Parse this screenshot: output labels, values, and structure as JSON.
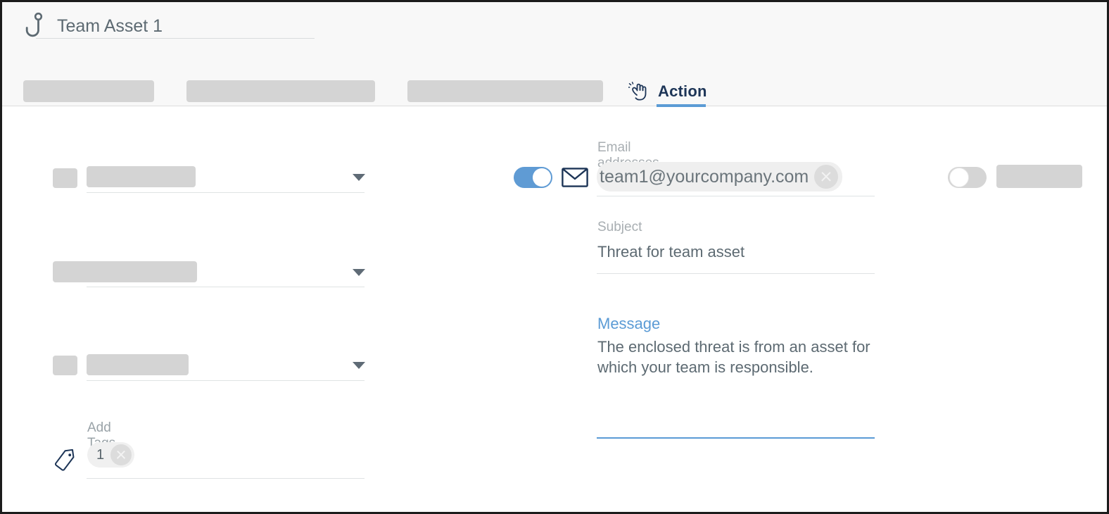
{
  "header": {
    "hook_icon": "fish-hook-icon",
    "asset_title": "Team Asset 1"
  },
  "tabs": {
    "redacted_count": 3,
    "active": {
      "icon": "hand-pointer-icon",
      "label": "Action"
    },
    "accent_color": "#5b9bd5"
  },
  "left_form": {
    "rows": [
      {
        "has_square": true,
        "redacted": true,
        "has_caret": true
      },
      {
        "has_square": false,
        "redacted": true,
        "has_caret": true
      },
      {
        "has_square": true,
        "redacted": true,
        "has_caret": true
      }
    ],
    "tags": {
      "icon": "tag-icon",
      "label": "Add Tags",
      "chips": [
        {
          "text": "1",
          "remove": "remove-tag-icon"
        }
      ]
    }
  },
  "email_action": {
    "enabled_toggle": {
      "state": "on",
      "color": "#5f9bd4"
    },
    "icon": "envelope-icon",
    "email_label": "Email addresses",
    "email_chips": [
      {
        "text": "team1@yourcompany.com",
        "remove": "remove-email-icon"
      }
    ],
    "subject_label": "Subject",
    "subject_value": "Threat for team asset",
    "message_label": "Message",
    "message_value": "The enclosed threat is from an asset for which your team is responsible.",
    "message_focus_color": "#5b9bd5"
  },
  "right_action": {
    "toggle": {
      "state": "off",
      "color": "#d5d5d5"
    },
    "redacted": true
  }
}
